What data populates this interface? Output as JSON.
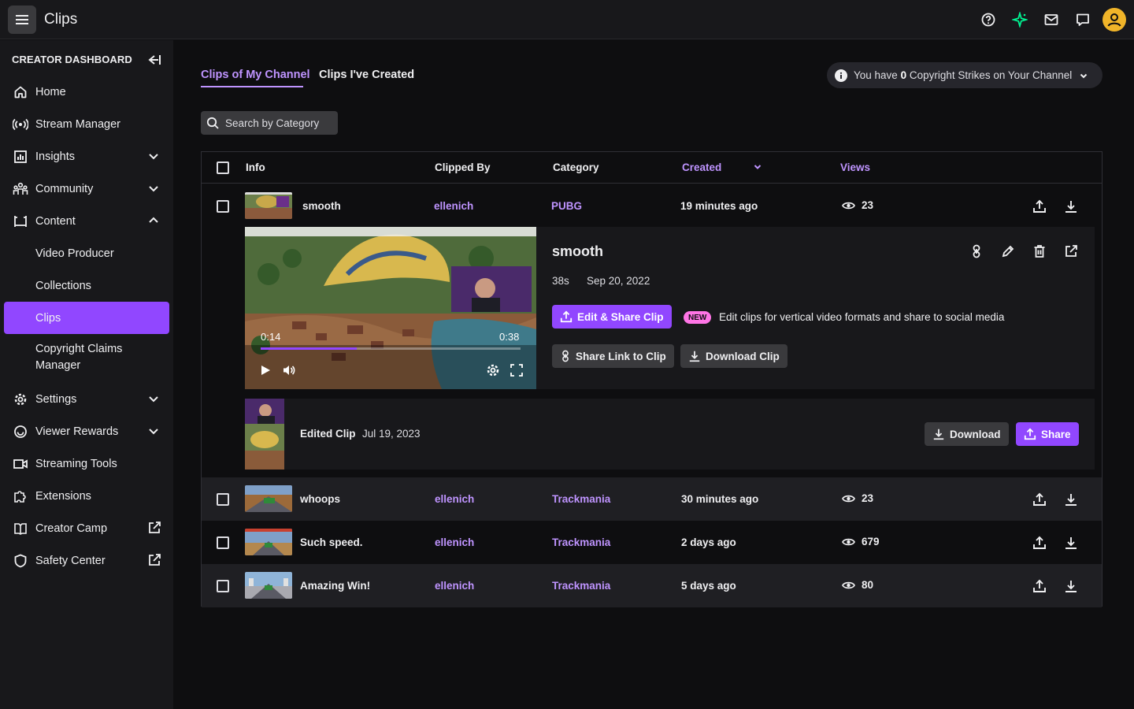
{
  "app": {
    "title": "Clips"
  },
  "colors": {
    "accent": "#9147ff",
    "accent_text": "#bf94ff",
    "new_badge": "#ff75e6",
    "background": "#0e0e10",
    "panel": "#18181b"
  },
  "topbar_icons": [
    "menu-icon",
    "help-icon",
    "sparkle-icon",
    "inbox-icon",
    "whispers-icon",
    "avatar-icon"
  ],
  "sidebar": {
    "heading": "CREATOR DASHBOARD",
    "items": [
      {
        "label": "Home",
        "icon": "home-icon"
      },
      {
        "label": "Stream Manager",
        "icon": "broadcast-icon"
      },
      {
        "label": "Insights",
        "icon": "chart-icon"
      },
      {
        "label": "Community",
        "icon": "people-icon"
      },
      {
        "label": "Content",
        "icon": "content-icon"
      },
      {
        "label": "Video Producer"
      },
      {
        "label": "Collections"
      },
      {
        "label": "Clips"
      },
      {
        "label": "Copyright Claims Manager"
      },
      {
        "label": "Settings",
        "icon": "gear-icon"
      },
      {
        "label": "Viewer Rewards",
        "icon": "rewards-icon"
      },
      {
        "label": "Streaming Tools",
        "icon": "camera-icon"
      },
      {
        "label": "Extensions",
        "icon": "puzzle-icon"
      },
      {
        "label": "Creator Camp",
        "icon": "book-icon"
      },
      {
        "label": "Safety Center",
        "icon": "shield-icon"
      }
    ]
  },
  "tabs": {
    "mine": "Clips of My Channel",
    "created": "Clips I've Created"
  },
  "strikes": {
    "prefix": "You have",
    "count": "0",
    "suffix": "Copyright Strikes on Your Channel"
  },
  "search": {
    "placeholder": "Search by Category"
  },
  "table": {
    "columns": {
      "info": "Info",
      "clipped_by": "Clipped By",
      "category": "Category",
      "created": "Created",
      "views": "Views"
    },
    "rows": [
      {
        "title": "smooth",
        "clipped_by": "ellenich",
        "category": "PUBG",
        "created": "19 minutes ago",
        "views": "23"
      },
      {
        "title": "whoops",
        "clipped_by": "ellenich",
        "category": "Trackmania",
        "created": "30 minutes ago",
        "views": "23"
      },
      {
        "title": "Such speed.",
        "clipped_by": "ellenich",
        "category": "Trackmania",
        "created": "2 days ago",
        "views": "679"
      },
      {
        "title": "Amazing Win!",
        "clipped_by": "ellenich",
        "category": "Trackmania",
        "created": "5 days ago",
        "views": "80"
      }
    ]
  },
  "expanded": {
    "title": "smooth",
    "duration": "38s",
    "date": "Sep 20, 2022",
    "player": {
      "current": "0:14",
      "total": "0:38",
      "progress": 0.37
    },
    "edit_share": "Edit & Share Clip",
    "new_badge": "NEW",
    "new_text": "Edit clips for vertical video formats and share to social media",
    "share_link": "Share Link to Clip",
    "download_clip": "Download Clip",
    "edited": {
      "title": "Edited Clip",
      "date": "Jul 19, 2023",
      "download": "Download",
      "share": "Share"
    }
  }
}
